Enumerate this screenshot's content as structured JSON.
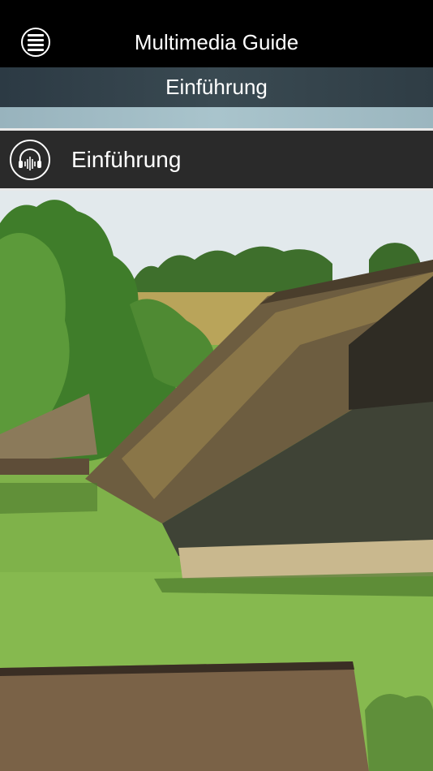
{
  "header": {
    "title": "Multimedia Guide",
    "menu_icon": "hamburger-menu-icon"
  },
  "section": {
    "title": "Einführung"
  },
  "track": {
    "title": "Einführung",
    "icon": "audio-headphones-icon"
  },
  "photo": {
    "colors": {
      "sky": "#dfe7ea",
      "grass": "#7fb24a",
      "roof": "#6a5a3f",
      "trees": "#3f7d2a"
    }
  }
}
